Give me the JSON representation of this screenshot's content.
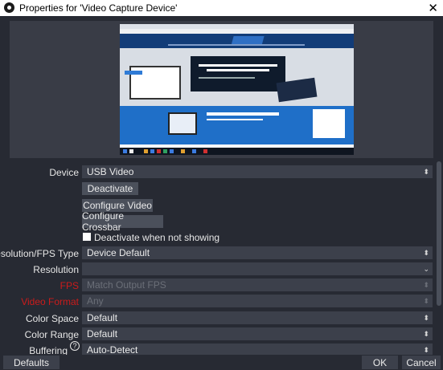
{
  "window": {
    "title": "Properties for 'Video Capture Device'",
    "close_glyph": "✕"
  },
  "fields": {
    "device": {
      "label": "Device",
      "value": "USB Video"
    },
    "resolution_fps_type": {
      "label": "Resolution/FPS Type",
      "value": "Device Default"
    },
    "resolution": {
      "label": "Resolution",
      "value": ""
    },
    "fps": {
      "label": "FPS",
      "value": "Match Output FPS"
    },
    "video_format": {
      "label": "Video Format",
      "value": "Any"
    },
    "color_space": {
      "label": "Color Space",
      "value": "Default"
    },
    "color_range": {
      "label": "Color Range",
      "value": "Default"
    },
    "buffering": {
      "label": "Buffering",
      "value": "Auto-Detect"
    }
  },
  "buttons": {
    "deactivate": "Deactivate",
    "configure_video": "Configure Video",
    "configure_crossbar": "Configure Crossbar",
    "defaults": "Defaults",
    "ok": "OK",
    "cancel": "Cancel"
  },
  "checkbox": {
    "label": "Deactivate when not showing",
    "checked": false
  },
  "icons": {
    "spin": "⬍",
    "dropdown": "⌄",
    "help": "?"
  },
  "colors": {
    "disabled_label": "#cc1b1b",
    "background": "#272a33",
    "field": "#3c404b"
  }
}
